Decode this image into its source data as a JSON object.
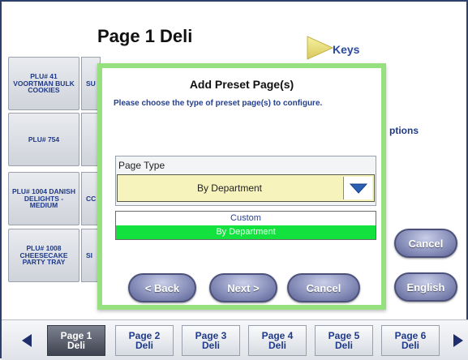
{
  "page": {
    "title": "Page 1 Deli",
    "keys_label": "Keys"
  },
  "plu_buttons": [
    {
      "label": "PLU# 41 VOORTMAN BULK COOKIES",
      "second": "SU"
    },
    {
      "label": "PLU# 754",
      "second": ""
    },
    {
      "label": "PLU# 1004 DANISH DELIGHTS - MEDIUM",
      "second": "CC"
    },
    {
      "label": "PLU# 1008 CHEESECAKE PARTY TRAY",
      "second": "SI"
    }
  ],
  "behind": {
    "options_text": "ptions",
    "cancel_label": "Cancel",
    "english_label": "English"
  },
  "modal": {
    "title": "Add Preset Page(s)",
    "subtitle": "Please choose the type of preset page(s) to configure.",
    "page_type_label": "Page Type",
    "selected_value": "By Department",
    "options": [
      "Custom",
      "By Department"
    ],
    "back_label": "< Back",
    "next_label": "Next >",
    "cancel_label": "Cancel"
  },
  "tabs": [
    {
      "line1": "Page 1",
      "line2": "Deli",
      "active": true
    },
    {
      "line1": "Page 2",
      "line2": "Deli",
      "active": false
    },
    {
      "line1": "Page 3",
      "line2": "Deli",
      "active": false
    },
    {
      "line1": "Page 4",
      "line2": "Deli",
      "active": false
    },
    {
      "line1": "Page 5",
      "line2": "Deli",
      "active": false
    },
    {
      "line1": "Page 6",
      "line2": "Deli",
      "active": false
    }
  ],
  "colors": {
    "modal_border": "#96e07f",
    "selected_option": "#12e13e",
    "select_bg": "#f7f3bd",
    "link_blue": "#2a4aa2"
  },
  "icons": {
    "keys": "triangle-right-icon",
    "dropdown": "chevron-down-icon",
    "prev": "triangle-left-icon",
    "next": "triangle-right-icon"
  }
}
